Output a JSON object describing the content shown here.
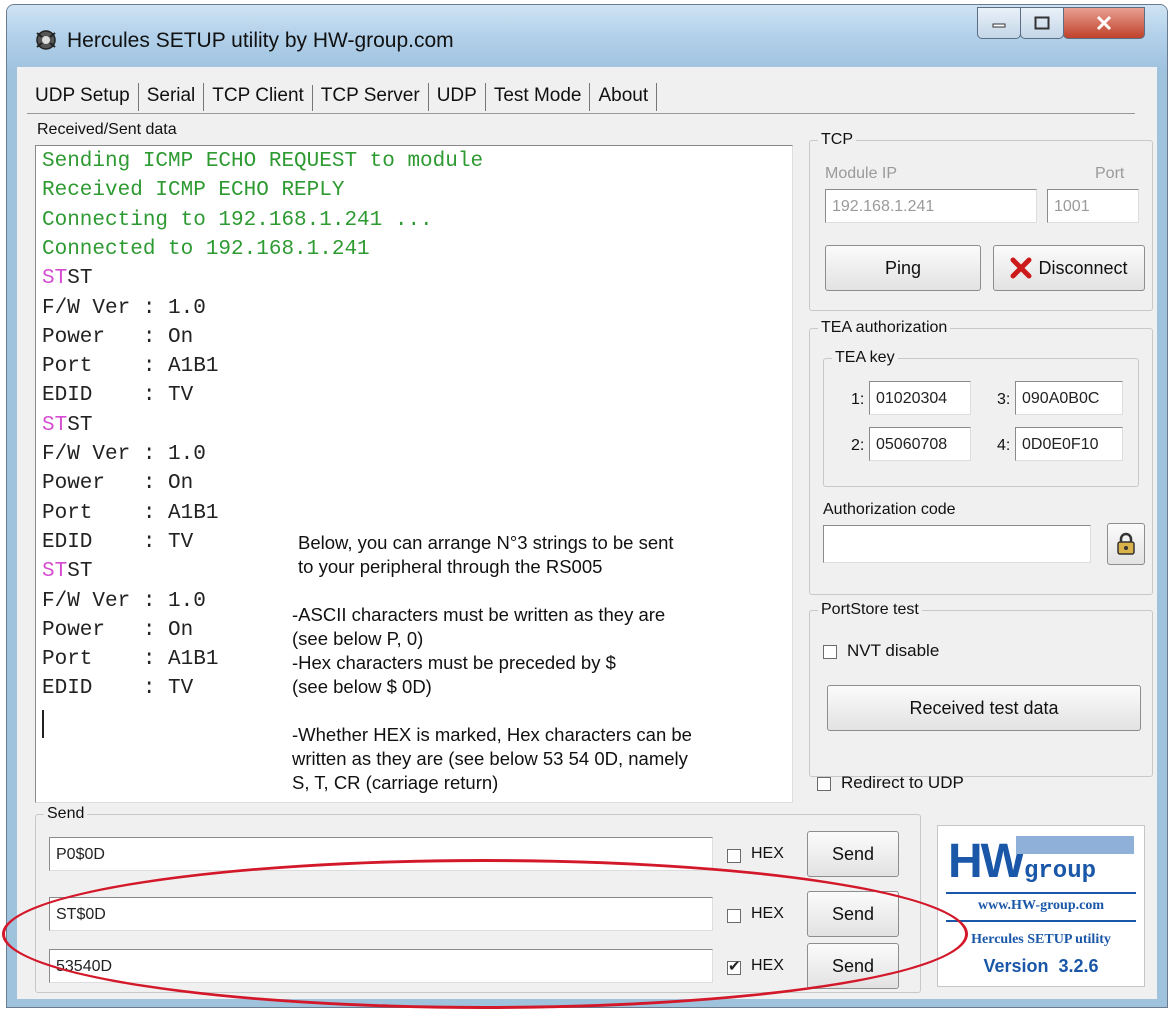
{
  "window": {
    "title": "Hercules SETUP utility by HW-group.com"
  },
  "tabs": [
    {
      "label": "UDP Setup"
    },
    {
      "label": "Serial"
    },
    {
      "label": "TCP Client",
      "active": true
    },
    {
      "label": "TCP Server"
    },
    {
      "label": "UDP"
    },
    {
      "label": "Test Mode"
    },
    {
      "label": "About"
    }
  ],
  "received": {
    "label": "Received/Sent data",
    "lines": [
      {
        "text": "Sending ICMP ECHO REQUEST to module",
        "color": "green"
      },
      {
        "text": "Received ICMP ECHO REPLY",
        "color": "green"
      },
      {
        "text": "Connecting to 192.168.1.241 ...",
        "color": "green"
      },
      {
        "text": "Connected to 192.168.1.241",
        "color": "green"
      },
      {
        "pre": "ST",
        "text": "ST",
        "color": "dark"
      },
      {
        "text": "F/W Ver : 1.0",
        "color": "dark"
      },
      {
        "text": "Power   : On",
        "color": "dark"
      },
      {
        "text": "Port    : A1B1",
        "color": "dark"
      },
      {
        "text": "EDID    : TV",
        "color": "dark"
      },
      {
        "pre": "ST",
        "text": "ST",
        "color": "dark"
      },
      {
        "text": "F/W Ver : 1.0",
        "color": "dark"
      },
      {
        "text": "Power   : On",
        "color": "dark"
      },
      {
        "text": "Port    : A1B1",
        "color": "dark"
      },
      {
        "text": "EDID    : TV",
        "color": "dark"
      },
      {
        "pre": "ST",
        "text": "ST",
        "color": "dark"
      },
      {
        "text": "F/W Ver : 1.0",
        "color": "dark"
      },
      {
        "text": "Power   : On",
        "color": "dark"
      },
      {
        "text": "Port    : A1B1",
        "color": "dark"
      },
      {
        "text": "EDID    : TV",
        "color": "dark"
      }
    ]
  },
  "notes": [
    "Below, you can arrange N°3 strings to be sent",
    "to your peripheral through the RS005",
    "-ASCII characters must be written as they are",
    " (see below P, 0)",
    "-Hex characters must be preceded by $",
    " (see below $ 0D)",
    "-Whether HEX is marked, Hex characters can be",
    " written as they are (see below 53 54 0D, namely",
    " S, T, CR (carriage return)"
  ],
  "tcp": {
    "legend": "TCP",
    "module_ip_label": "Module IP",
    "port_label": "Port",
    "module_ip": "192.168.1.241",
    "port": "1001",
    "ping_label": "Ping",
    "disconnect_label": "Disconnect"
  },
  "tea": {
    "legend": "TEA authorization",
    "key_legend": "TEA key",
    "keys": [
      {
        "idx": "1:",
        "value": "01020304"
      },
      {
        "idx": "2:",
        "value": "05060708"
      },
      {
        "idx": "3:",
        "value": "090A0B0C"
      },
      {
        "idx": "4:",
        "value": "0D0E0F10"
      }
    ],
    "auth_label": "Authorization code",
    "auth_value": ""
  },
  "portstore": {
    "legend": "PortStore test",
    "nvt_label": "NVT disable",
    "nvt_checked": false,
    "received_btn": "Received test data"
  },
  "redirect": {
    "label": "Redirect to UDP",
    "checked": false
  },
  "send": {
    "legend": "Send",
    "rows": [
      {
        "value": "P0$0D",
        "hex_label": "HEX",
        "hex_checked": false,
        "button": "Send"
      },
      {
        "value": "ST$0D",
        "hex_label": "HEX",
        "hex_checked": false,
        "button": "Send"
      },
      {
        "value": "53540D",
        "hex_label": "HEX",
        "hex_checked": true,
        "button": "Send"
      }
    ]
  },
  "logo": {
    "brand_main": "HW",
    "brand_sub": "group",
    "url": "www.HW-group.com",
    "product": "Hercules SETUP utility",
    "version": "Version  3.2.6"
  },
  "colors": {
    "green_text": "#2e9a32",
    "pink_text": "#d54bd1",
    "annotation": "#d3182a",
    "logo_blue": "#1a57a8"
  }
}
